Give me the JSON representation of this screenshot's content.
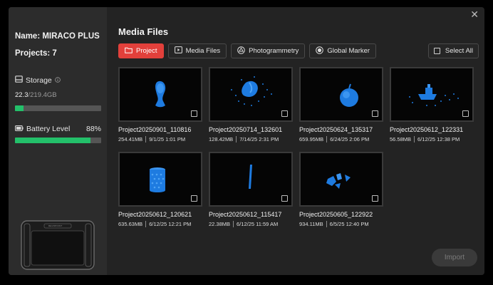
{
  "sidebar": {
    "name": "Name: MIRACO PLUS",
    "projects": "Projects: 7",
    "storage_label": "Storage",
    "storage_used": "22.3",
    "storage_total": "/219.4GB",
    "storage_fraction": 0.102,
    "battery_label": "Battery Level",
    "battery_percent": "88%",
    "battery_fraction": 0.88,
    "device_brand": "REVOPOINT"
  },
  "main": {
    "title": "Media Files",
    "tabs": [
      {
        "label": "Project",
        "icon": "folder-icon",
        "active": true
      },
      {
        "label": "Media Files",
        "icon": "video-icon",
        "active": false
      },
      {
        "label": "Photogrammetry",
        "icon": "aperture-icon",
        "active": false
      },
      {
        "label": "Global Marker",
        "icon": "target-icon",
        "active": false
      }
    ],
    "select_all": "Select All",
    "import": "Import",
    "close": "✕"
  },
  "projects": [
    {
      "name": "Project20250901_110816",
      "size": "254.41MB",
      "date": "9/1/25 1:01 PM"
    },
    {
      "name": "Project20250714_132601",
      "size": "128.42MB",
      "date": "7/14/25 2:31 PM"
    },
    {
      "name": "Project20250624_135317",
      "size": "659.95MB",
      "date": "6/24/25 2:06 PM"
    },
    {
      "name": "Project20250612_122331",
      "size": "56.58MB",
      "date": "6/12/25 12:38 PM"
    },
    {
      "name": "Project20250612_120621",
      "size": "635.63MB",
      "date": "6/12/25 12:21 PM"
    },
    {
      "name": "Project20250612_115417",
      "size": "22.38MB",
      "date": "6/12/25 11:59 AM"
    },
    {
      "name": "Project20250605_122922",
      "size": "934.11MB",
      "date": "6/5/25 12:40 PM"
    }
  ],
  "colors": {
    "accent": "#e2403b",
    "progress": "#23c06a",
    "model": "#1e7be0"
  }
}
